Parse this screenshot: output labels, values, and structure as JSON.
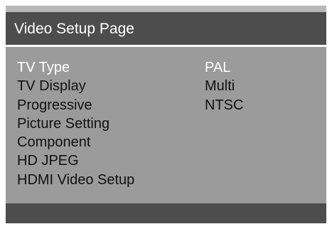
{
  "header": {
    "title": "Video Setup Page"
  },
  "menu": {
    "items": [
      {
        "label": "TV Type",
        "selected": true
      },
      {
        "label": "TV Display",
        "selected": false
      },
      {
        "label": "Progressive",
        "selected": false
      },
      {
        "label": "Picture Setting",
        "selected": false
      },
      {
        "label": "Component",
        "selected": false
      },
      {
        "label": "HD JPEG",
        "selected": false
      },
      {
        "label": "HDMI Video Setup",
        "selected": false
      }
    ]
  },
  "options": {
    "items": [
      {
        "label": "PAL",
        "selected": true
      },
      {
        "label": "Multi",
        "selected": false
      },
      {
        "label": "NTSC",
        "selected": false
      }
    ]
  },
  "colors": {
    "panel": "#9b9b9b",
    "header_bar": "#4d4d4d",
    "selected_text": "#ffffff",
    "normal_text": "#111111"
  }
}
